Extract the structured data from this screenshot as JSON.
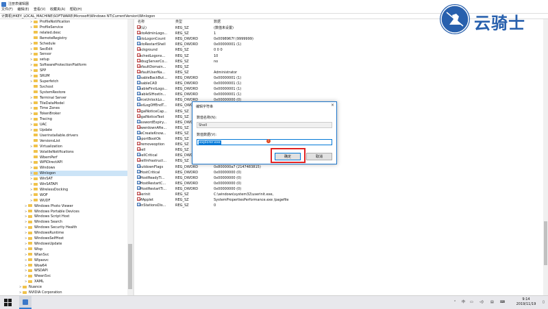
{
  "window": {
    "title": "注册表编辑器",
    "menu": [
      "文件(F)",
      "编辑(E)",
      "查看(V)",
      "收藏夹(A)",
      "帮助(H)"
    ],
    "address": "计算机\\HKEY_LOCAL_MACHINE\\SOFTWARE\\Microsoft\\Windows NT\\CurrentVersion\\Winlogon"
  },
  "tree": {
    "items": [
      {
        "label": "ProfileNotification",
        "level": 2,
        "expander": ">"
      },
      {
        "label": "ProfileService",
        "level": 2,
        "expander": ">"
      },
      {
        "label": "related.desc",
        "level": 2,
        "expander": ""
      },
      {
        "label": "RemoteRegistry",
        "level": 2,
        "expander": ""
      },
      {
        "label": "Schedule",
        "level": 2,
        "expander": ">"
      },
      {
        "label": "SecEdit",
        "level": 2,
        "expander": ">"
      },
      {
        "label": "Sensor",
        "level": 2,
        "expander": ">"
      },
      {
        "label": "setup",
        "level": 2,
        "expander": ">"
      },
      {
        "label": "SoftwareProtectionPlatform",
        "level": 2,
        "expander": ">"
      },
      {
        "label": "SPP",
        "level": 2,
        "expander": ">"
      },
      {
        "label": "SRUM",
        "level": 2,
        "expander": ">"
      },
      {
        "label": "Superfetch",
        "level": 2,
        "expander": ">"
      },
      {
        "label": "Svchost",
        "level": 2,
        "expander": ""
      },
      {
        "label": "SystemRestore",
        "level": 2,
        "expander": ""
      },
      {
        "label": "Terminal Server",
        "level": 2,
        "expander": ">"
      },
      {
        "label": "TileDataModel",
        "level": 2,
        "expander": ">"
      },
      {
        "label": "Time Zones",
        "level": 2,
        "expander": ">"
      },
      {
        "label": "TokenBroker",
        "level": 2,
        "expander": ">"
      },
      {
        "label": "Tracing",
        "level": 2,
        "expander": ">"
      },
      {
        "label": "UAC",
        "level": 2,
        "expander": ">"
      },
      {
        "label": "Update",
        "level": 2,
        "expander": ">"
      },
      {
        "label": "Userinstallable.drivers",
        "level": 2,
        "expander": ""
      },
      {
        "label": "VersionsList",
        "level": 2,
        "expander": ""
      },
      {
        "label": "Virtualization",
        "level": 2,
        "expander": ">"
      },
      {
        "label": "VolatileNotifications",
        "level": 2,
        "expander": ""
      },
      {
        "label": "WbemPerf",
        "level": 2,
        "expander": ""
      },
      {
        "label": "WiFiDirectAPI",
        "level": 2,
        "expander": ">"
      },
      {
        "label": "Windows",
        "level": 2,
        "expander": ">"
      },
      {
        "label": "Winlogon",
        "level": 2,
        "expander": ">",
        "selected": true
      },
      {
        "label": "WinSAT",
        "level": 2,
        "expander": ">"
      },
      {
        "label": "WinSATAPI",
        "level": 2,
        "expander": ">"
      },
      {
        "label": "WirelessDocking",
        "level": 2,
        "expander": ">"
      },
      {
        "label": "WOF",
        "level": 2,
        "expander": ">"
      },
      {
        "label": "WUDF",
        "level": 2,
        "expander": ">"
      },
      {
        "label": "Windows Photo Viewer",
        "level": 1,
        "expander": ">"
      },
      {
        "label": "Windows Portable Devices",
        "level": 1,
        "expander": ">"
      },
      {
        "label": "Windows Script Host",
        "level": 1,
        "expander": ">"
      },
      {
        "label": "Windows Search",
        "level": 1,
        "expander": ">"
      },
      {
        "label": "Windows Security Health",
        "level": 1,
        "expander": ">"
      },
      {
        "label": "WindowsRuntime",
        "level": 1,
        "expander": ">"
      },
      {
        "label": "WindowsSelfHost",
        "level": 1,
        "expander": ">"
      },
      {
        "label": "WindowsUpdate",
        "level": 1,
        "expander": ">"
      },
      {
        "label": "Wisp",
        "level": 1,
        "expander": ">"
      },
      {
        "label": "WlanSvc",
        "level": 1,
        "expander": ">"
      },
      {
        "label": "Wlpasvc",
        "level": 1,
        "expander": ">"
      },
      {
        "label": "Wow64",
        "level": 1,
        "expander": ">"
      },
      {
        "label": "WSDAPI",
        "level": 1,
        "expander": ">"
      },
      {
        "label": "WwanSvc",
        "level": 1,
        "expander": ">"
      },
      {
        "label": "XAML",
        "level": 1,
        "expander": ">"
      },
      {
        "label": "Nuance",
        "level": 0,
        "expander": ">"
      },
      {
        "label": "NVIDIA Corporation",
        "level": 0,
        "expander": ">"
      }
    ]
  },
  "list": {
    "headers": {
      "name": "名称",
      "type": "类型",
      "data": "数据"
    },
    "rows": [
      {
        "icon": "string-value-icon",
        "name": "(默认)",
        "type": "REG_SZ",
        "data": "(数值未设置)"
      },
      {
        "icon": "string-value-icon",
        "name": "AutoAdminLogo...",
        "type": "REG_SZ",
        "data": "1"
      },
      {
        "icon": "dword-value-icon",
        "name": "AutoLogonCount",
        "type": "REG_DWORD",
        "data": "0x0098967f (9999999)"
      },
      {
        "icon": "dword-value-icon",
        "name": "AutoRestartShell",
        "type": "REG_DWORD",
        "data": "0x00000001 (1)"
      },
      {
        "icon": "string-value-icon",
        "name": "Background",
        "type": "REG_SZ",
        "data": "0 0 0"
      },
      {
        "icon": "string-value-icon",
        "name": "CachedLogons...",
        "type": "REG_SZ",
        "data": "10"
      },
      {
        "icon": "string-value-icon",
        "name": "DebugServerCo...",
        "type": "REG_SZ",
        "data": "no"
      },
      {
        "icon": "string-value-icon",
        "name": "DefaultDomain...",
        "type": "REG_SZ",
        "data": ""
      },
      {
        "icon": "string-value-icon",
        "name": "DefaultUserNa...",
        "type": "REG_SZ",
        "data": "Administrator"
      },
      {
        "icon": "dword-value-icon",
        "name": "DisableBackBut...",
        "type": "REG_DWORD",
        "data": "0x00000001 (1)"
      },
      {
        "icon": "dword-value-icon",
        "name": "DisableCAD",
        "type": "REG_DWORD",
        "data": "0x00000001 (1)"
      },
      {
        "icon": "dword-value-icon",
        "name": "EnableFirstLogo...",
        "type": "REG_DWORD",
        "data": "0x00000001 (1)"
      },
      {
        "icon": "dword-value-icon",
        "name": "EnableSIHostIn...",
        "type": "REG_DWORD",
        "data": "0x00000001 (1)"
      },
      {
        "icon": "dword-value-icon",
        "name": "ForceUnlockLo...",
        "type": "REG_DWORD",
        "data": "0x00000000 (0)"
      },
      {
        "icon": "dword-value-icon",
        "name": "LastLogOffEndT...",
        "type": "REG_QWO",
        "data": ""
      },
      {
        "icon": "string-value-icon",
        "name": "LegalNoticeCap...",
        "type": "REG_SZ",
        "data": ""
      },
      {
        "icon": "string-value-icon",
        "name": "LegalNoticeText",
        "type": "REG_SZ",
        "data": ""
      },
      {
        "icon": "dword-value-icon",
        "name": "PasswordExpiry...",
        "type": "REG_DWO",
        "data": ""
      },
      {
        "icon": "string-value-icon",
        "name": "PowerdownAfte...",
        "type": "REG_SZ",
        "data": ""
      },
      {
        "icon": "dword-value-icon",
        "name": "PreCreateKnow...",
        "type": "REG_SZ",
        "data": ""
      },
      {
        "icon": "dword-value-icon",
        "name": "ReportBootOk",
        "type": "REG_SZ",
        "data": ""
      },
      {
        "icon": "string-value-icon",
        "name": "scremoveoption",
        "type": "REG_SZ",
        "data": ""
      },
      {
        "icon": "string-value-icon",
        "name": "Shell",
        "type": "REG_SZ",
        "data": ""
      },
      {
        "icon": "dword-value-icon",
        "name": "ShellCritical",
        "type": "REG_DWO",
        "data": ""
      },
      {
        "icon": "string-value-icon",
        "name": "ShellInfrastruct...",
        "type": "REG_SZ",
        "data": ""
      },
      {
        "icon": "dword-value-icon",
        "name": "ShutdownFlags",
        "type": "REG_DWORD",
        "data": "0x800000a7 (2147483815)"
      },
      {
        "icon": "dword-value-icon",
        "name": "SiHostCritical",
        "type": "REG_DWORD",
        "data": "0x00000000 (0)"
      },
      {
        "icon": "dword-value-icon",
        "name": "SiHostReadyTi...",
        "type": "REG_DWORD",
        "data": "0x00000000 (0)"
      },
      {
        "icon": "dword-value-icon",
        "name": "SiHostRestartC...",
        "type": "REG_DWORD",
        "data": "0x00000000 (0)"
      },
      {
        "icon": "dword-value-icon",
        "name": "SiHostRestartTi...",
        "type": "REG_DWORD",
        "data": "0x00000000 (0)"
      },
      {
        "icon": "string-value-icon",
        "name": "Userinit",
        "type": "REG_SZ",
        "data": "C:\\windows\\system32\\userinit.exe,"
      },
      {
        "icon": "string-value-icon",
        "name": "VMApplet",
        "type": "REG_SZ",
        "data": "SystemPropertiesPerformance.exe /pagefile"
      },
      {
        "icon": "dword-value-icon",
        "name": "WinStationsDis...",
        "type": "REG_SZ",
        "data": "0"
      }
    ]
  },
  "dialog": {
    "title": "编辑字符串",
    "close": "×",
    "name_label": "数值名称(N):",
    "name_value": "Shell",
    "data_label": "数值数据(V):",
    "data_value": "explorer.exe",
    "ok": "确定",
    "cancel": "取消"
  },
  "watermark": {
    "text": "云骑士"
  },
  "taskbar": {
    "time": "9:14",
    "date": "2019/11/19",
    "tray_lang": "中",
    "tray_icons": [
      "up-arrow-icon",
      "input-method-icon",
      "network-icon",
      "volume-icon",
      "notification-icon"
    ]
  },
  "colors": {
    "accent": "#0078d7",
    "highlight_box": "#e02020",
    "folder": "#f0c24b",
    "brand": "#2860ad"
  }
}
